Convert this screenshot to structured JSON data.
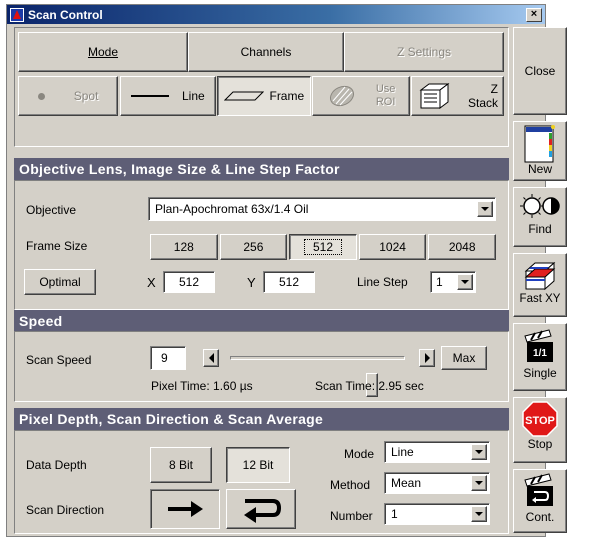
{
  "window": {
    "title": "Scan Control",
    "close_glyph": "×"
  },
  "tabs": {
    "mode": "Mode",
    "channels": "Channels",
    "z_settings": "Z Settings"
  },
  "modes": {
    "spot": "Spot",
    "line": "Line",
    "frame": "Frame",
    "use_roi_1": "Use",
    "use_roi_2": "ROI",
    "z_stack_1": "Z",
    "z_stack_2": "Stack"
  },
  "objective_section": {
    "header": "Objective Lens, Image Size & Line Step Factor",
    "objective_label": "Objective",
    "objective_value": "Plan-Apochromat 63x/1.4 Oil",
    "frame_size_label": "Frame Size",
    "frame_sizes": [
      "128",
      "256",
      "512",
      "1024",
      "2048"
    ],
    "selected_frame_size": "512",
    "optimal_label": "Optimal",
    "x_label": "X",
    "x_value": "512",
    "y_label": "Y",
    "y_value": "512",
    "line_step_label": "Line Step",
    "line_step_value": "1"
  },
  "speed_section": {
    "header": "Speed",
    "scan_speed_label": "Scan Speed",
    "scan_speed_value": "9",
    "slider_level_fraction": 0.75,
    "max_label": "Max",
    "pixel_time": "Pixel Time: 1.60 µs",
    "scan_time": "Scan Time: 2.95 sec"
  },
  "depth_section": {
    "header": "Pixel Depth, Scan Direction & Scan Average",
    "data_depth_label": "Data Depth",
    "bit8_label": "8 Bit",
    "bit12_label": "12 Bit",
    "scan_direction_label": "Scan Direction",
    "mode_label": "Mode",
    "mode_value": "Line",
    "method_label": "Method",
    "method_value": "Mean",
    "number_label": "Number",
    "number_value": "1"
  },
  "side_buttons": {
    "close": "Close",
    "new": "New",
    "find": "Find",
    "fast_xy": "Fast XY",
    "single": "Single",
    "stop": "Stop",
    "stop_sign": "STOP",
    "cont": "Cont."
  }
}
